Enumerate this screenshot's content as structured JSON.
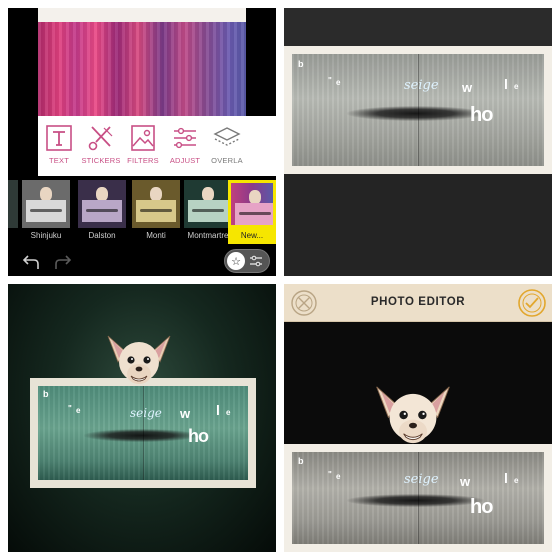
{
  "panel1": {
    "tools": [
      {
        "label": "TEXT",
        "icon": "text-box-icon"
      },
      {
        "label": "STICKERS",
        "icon": "scissors-icon"
      },
      {
        "label": "FILTERS",
        "icon": "image-icon"
      },
      {
        "label": "ADJUST",
        "icon": "sliders-icon"
      },
      {
        "label": "OVERLA",
        "icon": "layers-icon"
      }
    ],
    "filters": [
      {
        "label": "Shinjuku"
      },
      {
        "label": "Dalston"
      },
      {
        "label": "Monti"
      },
      {
        "label": "Montmartre"
      },
      {
        "label": "New..."
      }
    ],
    "colors": {
      "accent": "#c84f85",
      "selected_highlight": "#f6e600"
    }
  },
  "print_text": {
    "b": "b",
    "e": "e",
    "quote": "\"",
    "script": "seige",
    "w": "w",
    "l": "l",
    "e2": "e",
    "ho": "ho"
  },
  "panel4": {
    "title": "PHOTO EDITOR"
  }
}
